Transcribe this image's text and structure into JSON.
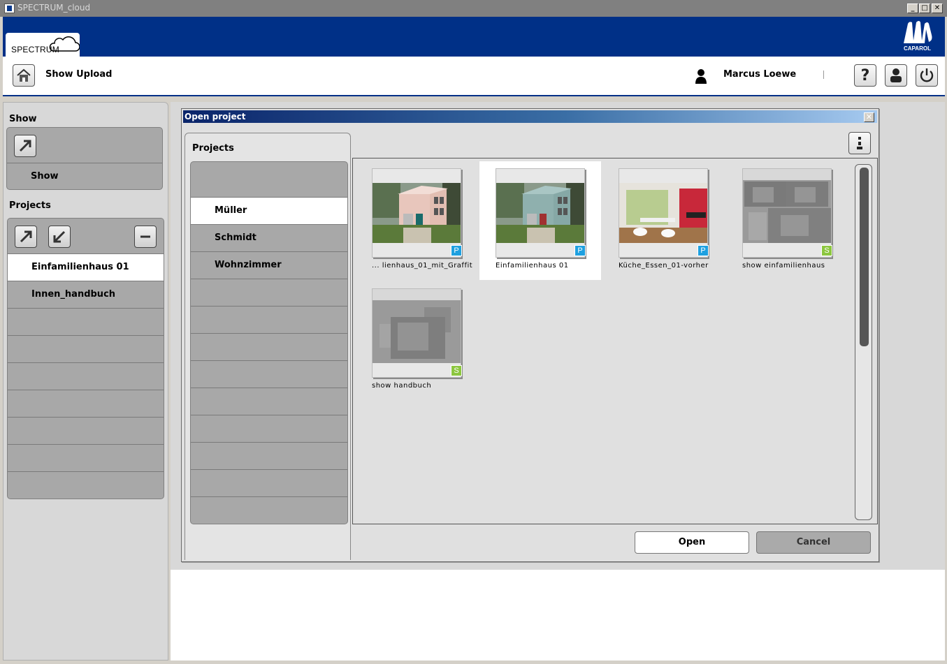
{
  "window": {
    "title": "SPECTRUM_cloud",
    "controls": [
      "_",
      "□",
      "✕"
    ]
  },
  "brand": {
    "tab_label": "SPECTRUM",
    "logo_text": "CAPAROL",
    "header_color": "#003087"
  },
  "toolbar": {
    "page_title": "Show Upload",
    "user_name": "Marcus Loewe",
    "icons": [
      "home-icon",
      "person-icon",
      "help-icon",
      "account-icon",
      "power-icon"
    ]
  },
  "sidebar": {
    "show_section": {
      "title": "Show",
      "items": [
        "Show"
      ]
    },
    "projects_section": {
      "title": "Projects",
      "items": [
        "Einfamilienhaus 01",
        "Innen_handbuch",
        "",
        "",
        "",
        "",
        "",
        "",
        ""
      ],
      "selected": "Einfamilienhaus 01"
    }
  },
  "dialog": {
    "title": "Open project",
    "close": "✕",
    "projects_title": "Projects",
    "projects": [
      "",
      "Müller",
      "Schmidt",
      "Wohnzimmer",
      "",
      "",
      "",
      "",
      "",
      "",
      "",
      "",
      ""
    ],
    "selected_project": "Müller",
    "tiles": [
      {
        "caption": "... lienhaus_01_mit_Graffit",
        "badge": "P",
        "kind": "pink-house"
      },
      {
        "caption": "Einfamilienhaus 01",
        "badge": "P",
        "kind": "blue-house",
        "selected": true
      },
      {
        "caption": "Küche_Essen_01-vorher",
        "badge": "P",
        "kind": "interior"
      },
      {
        "caption": "show einfamilienhaus",
        "badge": "S",
        "kind": "gray-collage"
      },
      {
        "caption": "show handbuch",
        "badge": "S",
        "kind": "gray-single"
      }
    ],
    "buttons": {
      "open": "Open",
      "cancel": "Cancel"
    }
  }
}
